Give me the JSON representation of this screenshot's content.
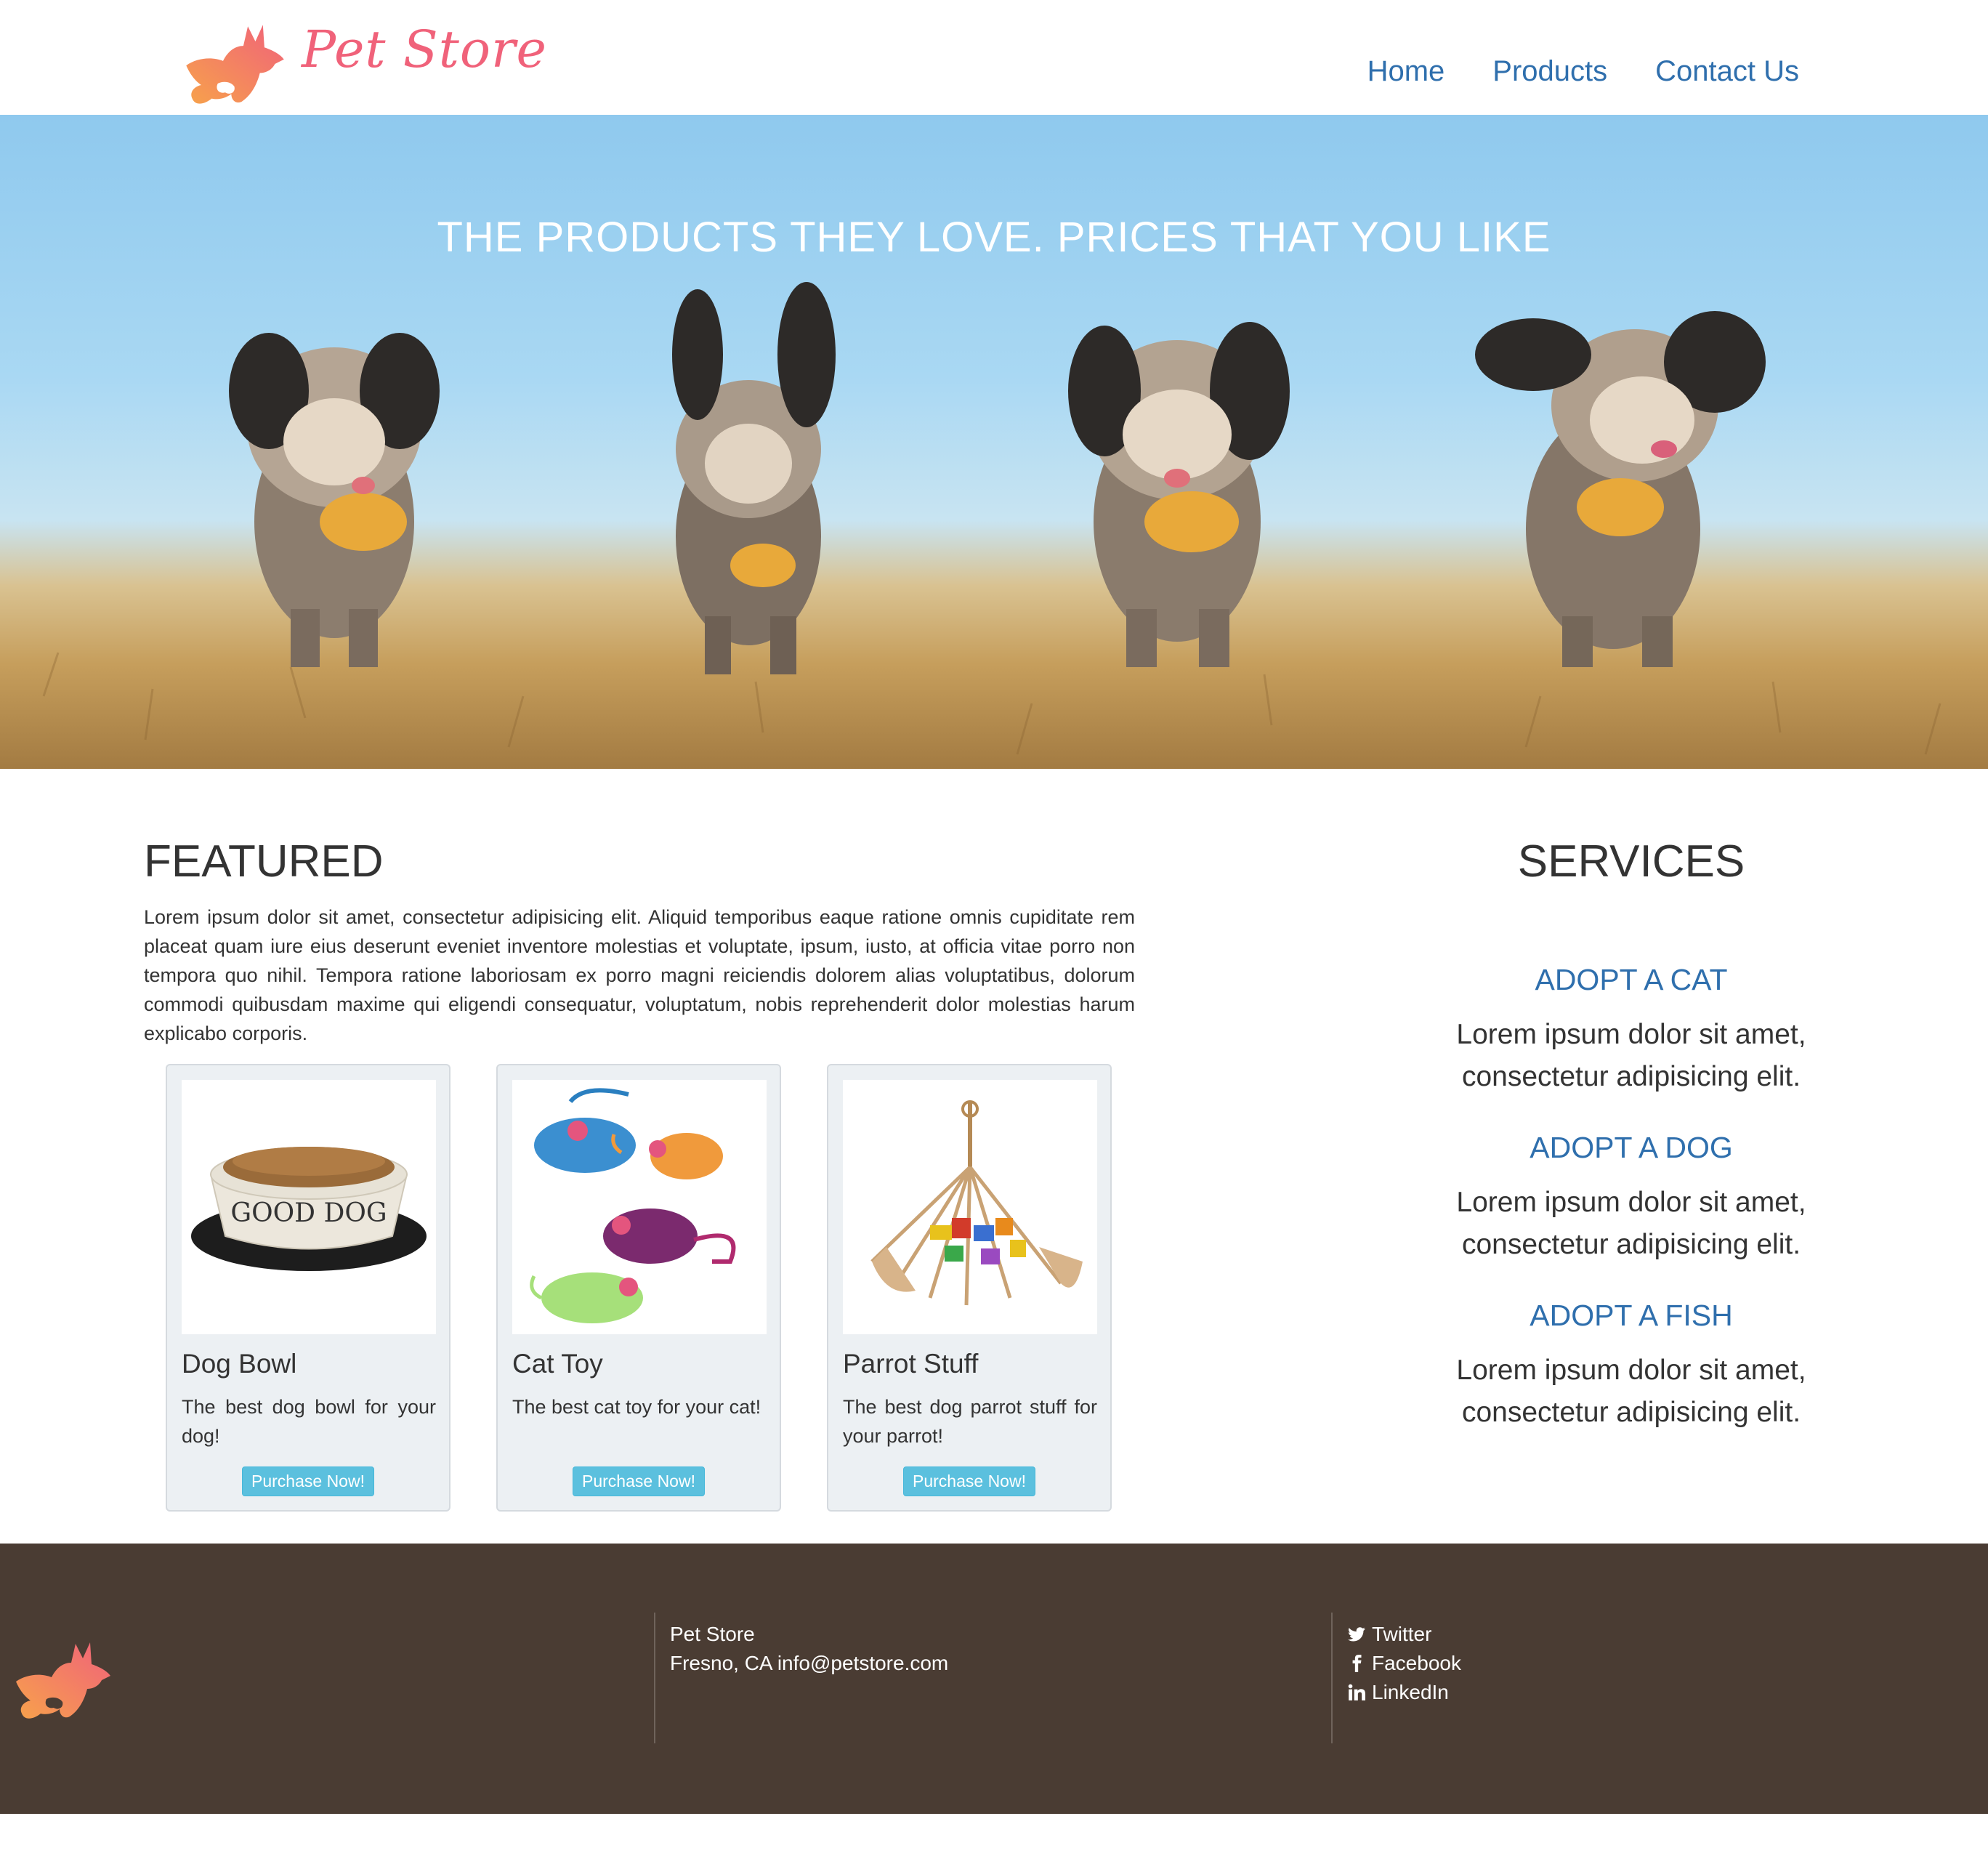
{
  "brand": {
    "name": "Pet Store",
    "logo_icon": "dog-logo-icon",
    "logo_colors": [
      "#f7a24b",
      "#f0627a"
    ]
  },
  "nav": {
    "items": [
      {
        "label": "Home"
      },
      {
        "label": "Products"
      },
      {
        "label": "Contact Us"
      }
    ],
    "link_color": "#2f6fad"
  },
  "hero": {
    "title": "THE PRODUCTS THEY LOVE. PRICES THAT YOU LIKE"
  },
  "featured": {
    "title": "FEATURED",
    "text": "Lorem ipsum dolor sit amet, consectetur adipisicing elit. Aliquid temporibus eaque ratione omnis cupiditate rem placeat quam iure eius deserunt eveniet inventore molestias et voluptate, ipsum, iusto, at officia vitae porro non tempora quo nihil. Tempora ratione laboriosam ex porro magni reiciendis dolorem alias voluptatibus, dolorum commodi quibusdam maxime qui eligendi consequatur, voluptatum, nobis reprehenderit dolor molestias harum explicabo corporis.",
    "products": [
      {
        "name": "Dog Bowl",
        "description": "The best dog bowl for your dog!",
        "button": "Purchase Now!",
        "image_label": "GOOD DOG"
      },
      {
        "name": "Cat Toy",
        "description": "The best cat toy for your cat!",
        "button": "Purchase Now!"
      },
      {
        "name": "Parrot Stuff",
        "description": "The best dog parrot stuff for your parrot!",
        "button": "Purchase Now!"
      }
    ],
    "button_color": "#5bc0de"
  },
  "services": {
    "title": "SERVICES",
    "items": [
      {
        "heading": "ADOPT A CAT",
        "text": "Lorem ipsum dolor sit amet, consectetur adipisicing elit."
      },
      {
        "heading": "ADOPT A DOG",
        "text": "Lorem ipsum dolor sit amet, consectetur adipisicing elit."
      },
      {
        "heading": "ADOPT A FISH",
        "text": "Lorem ipsum dolor sit amet, consectetur adipisicing elit."
      }
    ]
  },
  "footer": {
    "background": "#4a3c33",
    "company": "Pet Store",
    "address": "Fresno, CA info@petstore.com",
    "social": [
      {
        "label": "Twitter",
        "icon": "twitter-icon"
      },
      {
        "label": "Facebook",
        "icon": "facebook-icon"
      },
      {
        "label": "LinkedIn",
        "icon": "linkedin-icon"
      }
    ]
  }
}
